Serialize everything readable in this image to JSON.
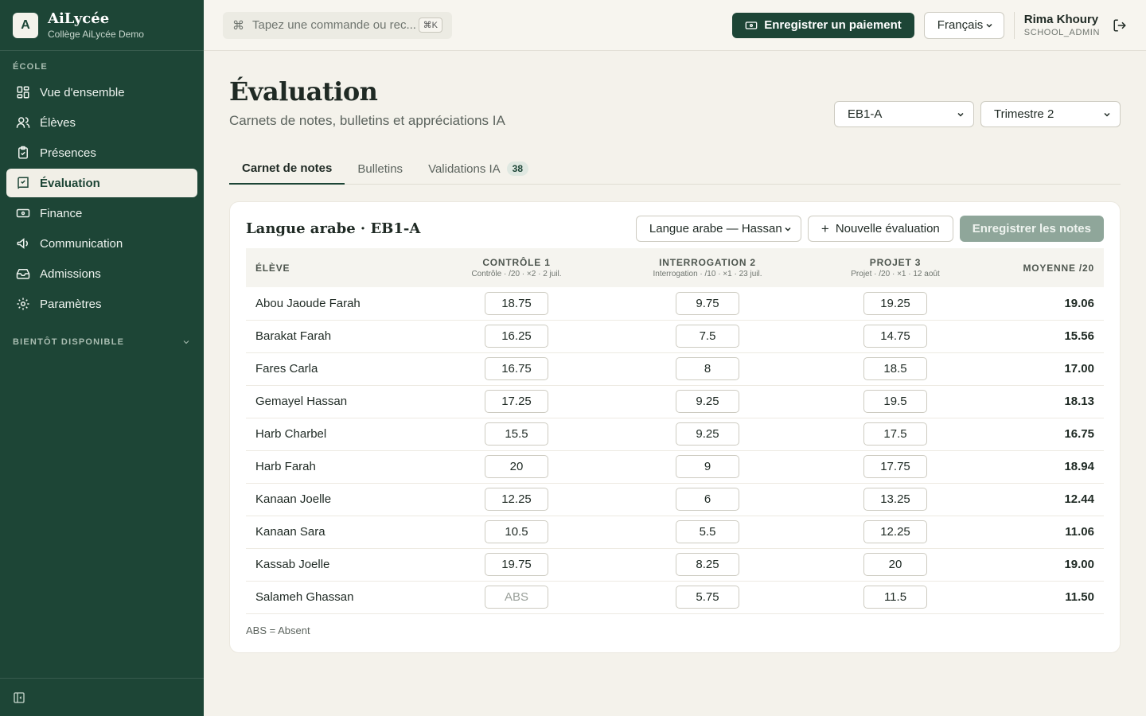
{
  "brand": {
    "logo": "A",
    "name": "AiLycée",
    "school": "Collège AiLycée Demo"
  },
  "sidebar": {
    "section": "ÉCOLE",
    "items": [
      {
        "label": "Vue d'ensemble",
        "icon": "dashboard-icon"
      },
      {
        "label": "Élèves",
        "icon": "users-icon"
      },
      {
        "label": "Présences",
        "icon": "clipboard-check-icon"
      },
      {
        "label": "Évaluation",
        "icon": "book-check-icon",
        "active": true
      },
      {
        "label": "Finance",
        "icon": "banknote-icon"
      },
      {
        "label": "Communication",
        "icon": "megaphone-icon"
      },
      {
        "label": "Admissions",
        "icon": "inbox-icon"
      },
      {
        "label": "Paramètres",
        "icon": "gear-icon"
      }
    ],
    "soon_label": "BIENTÔT DISPONIBLE"
  },
  "topbar": {
    "command_placeholder": "Tapez une commande ou rec...",
    "command_kbd": "⌘K",
    "payment_button": "Enregistrer un paiement",
    "language": "Français",
    "user_name": "Rima Khoury",
    "user_role": "SCHOOL_ADMIN"
  },
  "page": {
    "title": "Évaluation",
    "subtitle": "Carnets de notes, bulletins et appréciations IA",
    "class_select": "EB1-A",
    "term_select": "Trimestre 2"
  },
  "tabs": [
    {
      "label": "Carnet de notes"
    },
    {
      "label": "Bulletins"
    },
    {
      "label": "Validations IA",
      "badge": "38"
    }
  ],
  "gradebook": {
    "title": "Langue arabe · EB1-A",
    "subject_select": "Langue arabe — Hassan",
    "new_button": "Nouvelle évaluation",
    "save_button": "Enregistrer les notes",
    "columns": {
      "student": "Élève",
      "c1": "Contrôle 1",
      "c1_meta": "Contrôle · /20 · ×2 · 2 juil.",
      "c2": "Interrogation 2",
      "c2_meta": "Interrogation · /10 · ×1 · 23 juil.",
      "c3": "Projet 3",
      "c3_meta": "Projet · /20 · ×1 · 12 août",
      "avg": "Moyenne /20"
    },
    "rows": [
      {
        "name": "Abou Jaoude Farah",
        "c1": "18.75",
        "c2": "9.75",
        "c3": "19.25",
        "avg": "19.06"
      },
      {
        "name": "Barakat Farah",
        "c1": "16.25",
        "c2": "7.5",
        "c3": "14.75",
        "avg": "15.56"
      },
      {
        "name": "Fares Carla",
        "c1": "16.75",
        "c2": "8",
        "c3": "18.5",
        "avg": "17.00"
      },
      {
        "name": "Gemayel Hassan",
        "c1": "17.25",
        "c2": "9.25",
        "c3": "19.5",
        "avg": "18.13"
      },
      {
        "name": "Harb Charbel",
        "c1": "15.5",
        "c2": "9.25",
        "c3": "17.5",
        "avg": "16.75"
      },
      {
        "name": "Harb Farah",
        "c1": "20",
        "c2": "9",
        "c3": "17.75",
        "avg": "18.94"
      },
      {
        "name": "Kanaan Joelle",
        "c1": "12.25",
        "c2": "6",
        "c3": "13.25",
        "avg": "12.44"
      },
      {
        "name": "Kanaan Sara",
        "c1": "10.5",
        "c2": "5.5",
        "c3": "12.25",
        "avg": "11.06"
      },
      {
        "name": "Kassab Joelle",
        "c1": "19.75",
        "c2": "8.25",
        "c3": "20",
        "avg": "19.00"
      },
      {
        "name": "Salameh Ghassan",
        "c1": "",
        "c1_placeholder": "ABS",
        "c2": "5.75",
        "c3": "11.5",
        "avg": "11.50"
      }
    ],
    "legend": "ABS = Absent"
  }
}
